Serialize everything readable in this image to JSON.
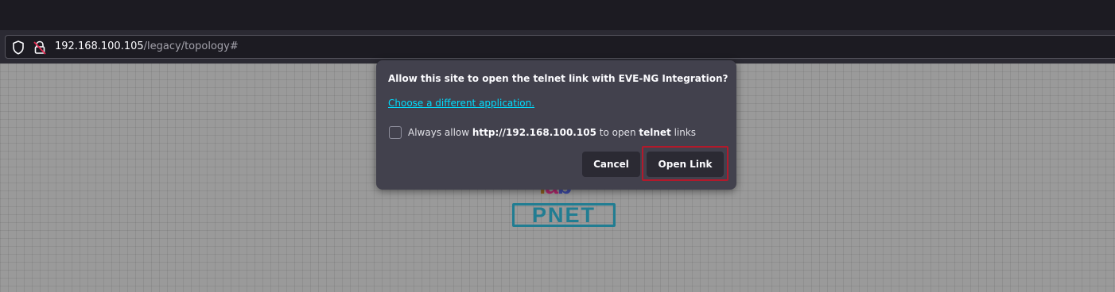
{
  "browser": {
    "url_host": "192.168.100.105",
    "url_path": "/legacy/topology#"
  },
  "logo": {
    "lab_text": [
      "l",
      "a",
      "b"
    ],
    "pnet_text": "PNET"
  },
  "dialog": {
    "title": "Allow this site to open the telnet link with EVE-NG Integration?",
    "choose_link": "Choose a different application.",
    "checkbox_checked": false,
    "checkbox_label": {
      "prefix": "Always allow ",
      "site": "http://192.168.100.105",
      "middle": " to open ",
      "protocol": "telnet",
      "suffix": " links"
    },
    "cancel_label": "Cancel",
    "open_label": "Open Link"
  },
  "colors": {
    "link": "#00ddff",
    "dialog_bg": "#42414d",
    "highlight": "#b3192b"
  }
}
